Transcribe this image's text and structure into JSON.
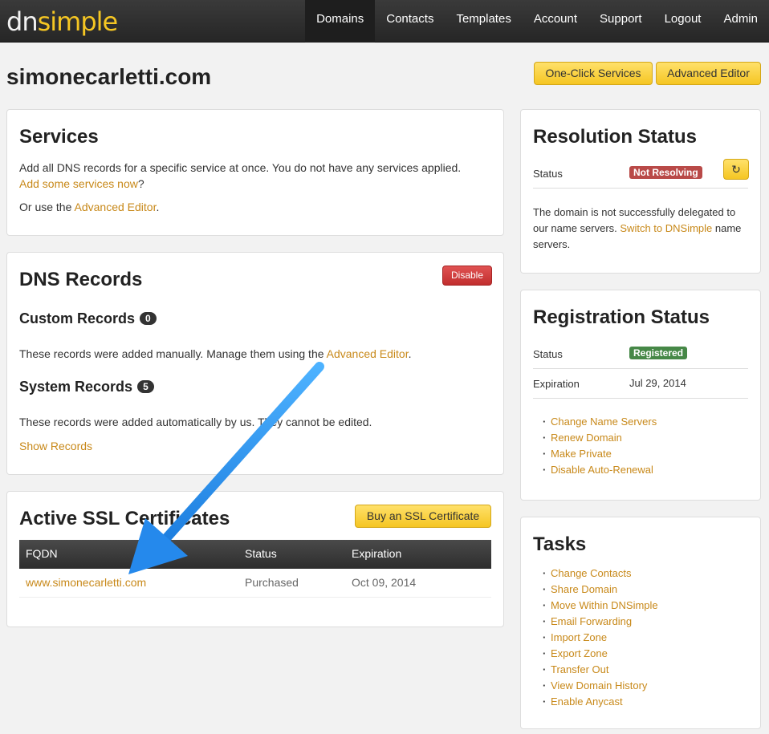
{
  "brand": {
    "left": "dn",
    "right": "simple"
  },
  "nav": {
    "domains": "Domains",
    "contacts": "Contacts",
    "templates": "Templates",
    "account": "Account",
    "support": "Support",
    "logout": "Logout",
    "admin": "Admin"
  },
  "page": {
    "title": "simonecarletti.com",
    "oneclick_label": "One-Click Services",
    "advanced_editor_label": "Advanced Editor"
  },
  "services": {
    "heading": "Services",
    "desc": "Add all DNS records for a specific service at once. You do not have any services applied.",
    "add_link": "Add some services now",
    "add_suffix": "?",
    "or_prefix": "Or use the",
    "adv_link": "Advanced Editor",
    "or_suffix": "."
  },
  "dns": {
    "heading": "DNS Records",
    "disable_label": "Disable",
    "custom_heading": "Custom Records",
    "custom_count": "0",
    "custom_prefix": "These records were added manually. Manage them using the",
    "custom_link": "Advanced Editor",
    "custom_suffix": ".",
    "system_heading": "System Records",
    "system_count": "5",
    "system_desc": "These records were added automatically by us. They cannot be edited.",
    "show_records": "Show Records"
  },
  "ssl": {
    "heading": "Active SSL Certificates",
    "buy_label": "Buy an SSL Certificate",
    "columns": {
      "fqdn": "FQDN",
      "status": "Status",
      "expiration": "Expiration"
    },
    "rows": [
      {
        "fqdn": "www.simonecarletti.com",
        "status": "Purchased",
        "expiration": "Oct 09, 2014"
      }
    ]
  },
  "resolution": {
    "heading": "Resolution Status",
    "status_label": "Status",
    "status_value": "Not Resolving",
    "desc_prefix": "The domain is not successfully delegated to our name servers.",
    "desc_link": "Switch to DNSimple",
    "desc_suffix": "name servers."
  },
  "registration": {
    "heading": "Registration Status",
    "status_label": "Status",
    "status_value": "Registered",
    "expiration_label": "Expiration",
    "expiration_value": "Jul 29, 2014",
    "links": [
      "Change Name Servers",
      "Renew Domain",
      "Make Private",
      "Disable Auto-Renewal"
    ]
  },
  "tasks": {
    "heading": "Tasks",
    "links": [
      "Change Contacts",
      "Share Domain",
      "Move Within DNSimple",
      "Email Forwarding",
      "Import Zone",
      "Export Zone",
      "Transfer Out",
      "View Domain History",
      "Enable Anycast"
    ]
  },
  "colors": {
    "accent": "#c8891a",
    "button_yellow": "#f5c623",
    "danger": "#b94a48",
    "success": "#468847",
    "annotation_arrow": "#1e90ff"
  },
  "icons": {
    "refresh": "refresh-icon"
  }
}
